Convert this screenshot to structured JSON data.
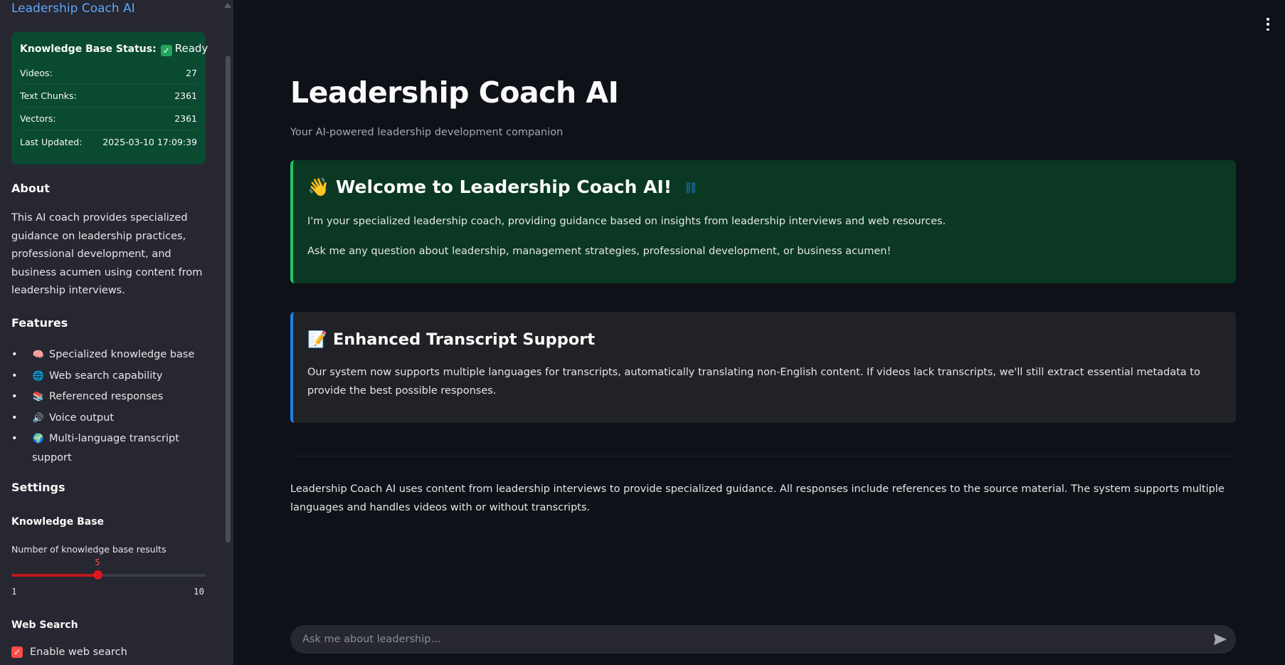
{
  "sidebar": {
    "title": "Leadership Coach AI",
    "kb_status": {
      "label": "Knowledge Base Status:",
      "status": "Ready",
      "rows": [
        {
          "label": "Videos:",
          "value": "27"
        },
        {
          "label": "Text Chunks:",
          "value": "2361"
        },
        {
          "label": "Vectors:",
          "value": "2361"
        },
        {
          "label": "Last Updated:",
          "value": "2025-03-10 17:09:39"
        }
      ]
    },
    "about": {
      "heading": "About",
      "text": "This AI coach provides specialized guidance on leadership practices, professional development, and business acumen using content from leadership interviews."
    },
    "features": {
      "heading": "Features",
      "items": [
        {
          "emoji": "🧠",
          "label": "Specialized knowledge base"
        },
        {
          "emoji": "🌐",
          "label": "Web search capability"
        },
        {
          "emoji": "📚",
          "label": "Referenced responses"
        },
        {
          "emoji": "🔊",
          "label": "Voice output"
        },
        {
          "emoji": "🌍",
          "label": "Multi-language transcript support"
        }
      ]
    },
    "settings": {
      "heading": "Settings",
      "knowledge_base": {
        "heading": "Knowledge Base",
        "slider_label": "Number of knowledge base results",
        "value": "5",
        "min": "1",
        "max": "10"
      },
      "web_search": {
        "heading": "Web Search",
        "checkbox_label": "Enable web search",
        "checked": true
      }
    }
  },
  "main": {
    "title": "Leadership Coach AI",
    "subtitle": "Your AI-powered leadership development companion",
    "welcome": {
      "emoji": "👋",
      "heading": "Welcome to Leadership Coach AI!",
      "p1": "I'm your specialized leadership coach, providing guidance based on insights from leadership interviews and web resources.",
      "p2": "Ask me any question about leadership, management strategies, professional development, or business acumen!"
    },
    "transcript": {
      "emoji": "📝",
      "heading": "Enhanced Transcript Support",
      "text": "Our system now supports multiple languages for transcripts, automatically translating non-English content. If videos lack transcripts, we'll still extract essential metadata to provide the best possible responses."
    },
    "footer": "Leadership Coach AI uses content from leadership interviews to provide specialized guidance. All responses include references to the source material. The system supports multiple languages and handles videos with or without transcripts.",
    "chat_input": {
      "placeholder": "Ask me about leadership..."
    }
  },
  "colors": {
    "accent": "#ff4b4b",
    "link": "#60a5fa",
    "success_bg": "#0a3823",
    "info_border": "#1c83e1"
  },
  "icons": [
    "link-icon",
    "send-icon",
    "menu-icon",
    "check-icon"
  ]
}
